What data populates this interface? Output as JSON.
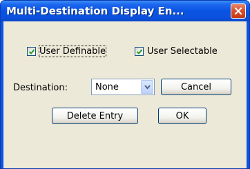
{
  "window": {
    "title": "Multi-Destination Display En..."
  },
  "checkboxes": {
    "user_definable": {
      "label": "User Definable",
      "checked": true
    },
    "user_selectable": {
      "label": "User Selectable",
      "checked": true
    }
  },
  "destination": {
    "label": "Destination:",
    "value": "None"
  },
  "buttons": {
    "cancel": "Cancel",
    "delete_entry": "Delete Entry",
    "ok": "OK"
  },
  "icons": {
    "close": "close-icon",
    "check": "checkmark-icon",
    "dropdown": "chevron-down-icon"
  },
  "colors": {
    "titlebar": "#0a54e3",
    "close_button": "#d9512a",
    "dialog_bg": "#ece9d8",
    "check_mark": "#21a121"
  }
}
